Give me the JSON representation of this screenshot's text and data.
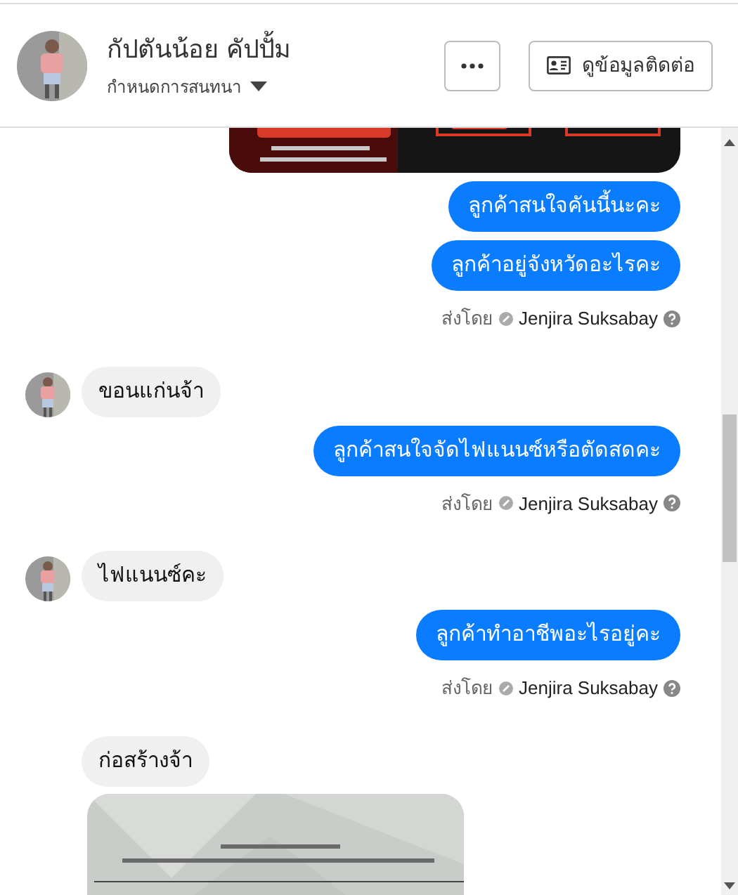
{
  "header": {
    "name": "กัปตันน้อย คัปปั้ม",
    "subtitle": "กำหนดการสนทนา",
    "contact_button": "ดูข้อมูลติดต่อ"
  },
  "messages": [
    {
      "kind": "picture"
    },
    {
      "kind": "outgoing",
      "text": "ลูกค้าสนใจคันนี้นะคะ"
    },
    {
      "kind": "outgoing",
      "text": "ลูกค้าอยู่จังหวัดอะไรคะ"
    },
    {
      "kind": "sent_by",
      "label": "ส่งโดย",
      "sender": "Jenjira Suksabay"
    },
    {
      "kind": "incoming",
      "text": "ขอนแก่นจ้า",
      "avatar": true
    },
    {
      "kind": "outgoing",
      "text": "ลูกค้าสนใจจัดไฟแนนซ์หรือตัดสดคะ"
    },
    {
      "kind": "sent_by",
      "label": "ส่งโดย",
      "sender": "Jenjira Suksabay"
    },
    {
      "kind": "incoming",
      "text": "ไฟแนนซ์คะ",
      "avatar": true
    },
    {
      "kind": "outgoing",
      "text": "ลูกค้าทำอาชีพอะไรอยู่คะ"
    },
    {
      "kind": "sent_by",
      "label": "ส่งโดย",
      "sender": "Jenjira Suksabay"
    },
    {
      "kind": "incoming",
      "text": "ก่อสร้างจ้า",
      "avatar": false
    },
    {
      "kind": "incoming_picture"
    }
  ]
}
